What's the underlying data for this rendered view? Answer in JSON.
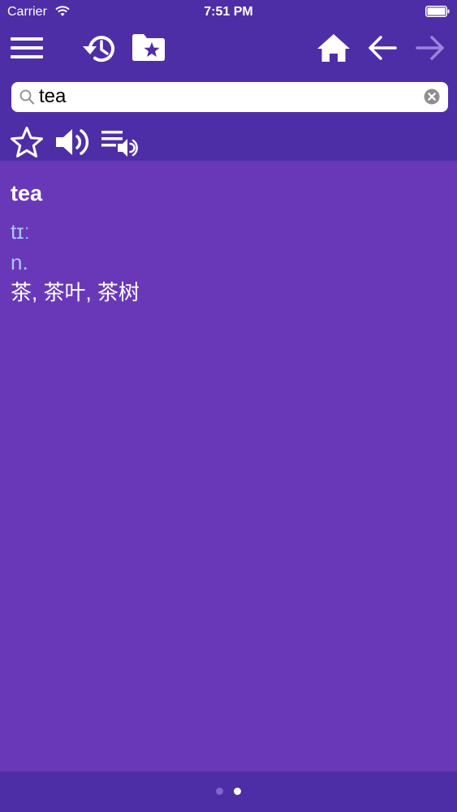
{
  "status_bar": {
    "carrier": "Carrier",
    "time": "7:51 PM"
  },
  "toolbar": {
    "icons": [
      "menu-icon",
      "history-icon",
      "bookmark-folder-icon",
      "home-icon",
      "back-arrow-icon",
      "forward-arrow-icon"
    ]
  },
  "search": {
    "value": "tea"
  },
  "entry": {
    "word": "tea",
    "phonetic": "tɪː",
    "part_of_speech": "n.",
    "translation": "茶, 茶叶, 茶树"
  },
  "colors": {
    "header": "#4e2ea6",
    "background": "#6938b9",
    "phonetic": "#a9c8ff"
  },
  "pager": {
    "count": 2,
    "active": 2
  }
}
